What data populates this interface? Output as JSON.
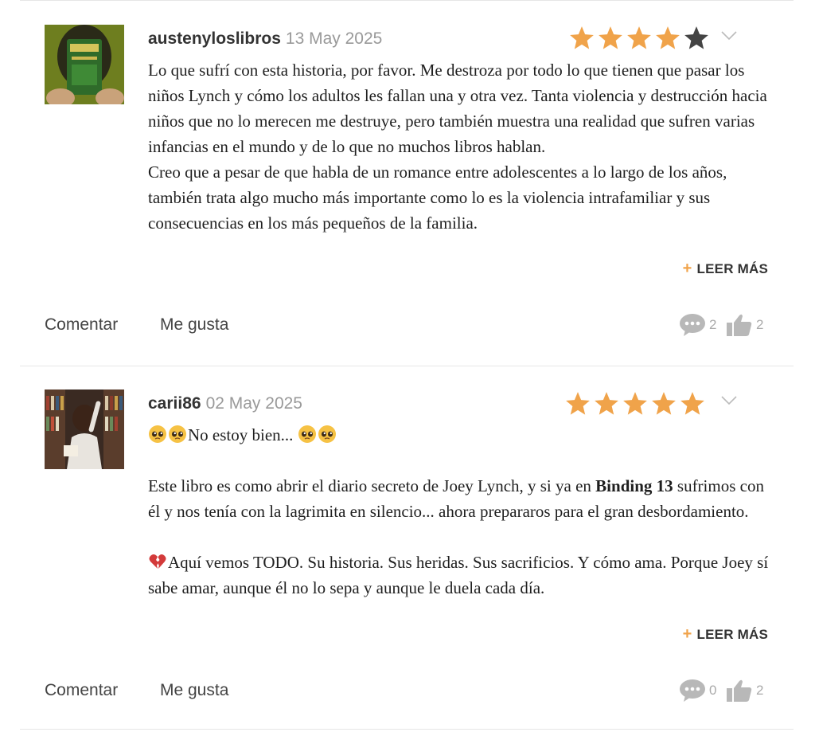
{
  "reviews": [
    {
      "username": "austenyloslibros",
      "date": "13 May 2025",
      "rating": 4,
      "max_rating": 5,
      "body_paragraphs": [
        "Lo que sufrí con esta historia, por favor. Me destroza por todo lo que tienen que pasar los niños Lynch y cómo los adultos les fallan una y otra vez. Tanta violencia y destrucción hacia niños que no lo merecen me destruye, pero también muestra una realidad que sufren varias infancias en el mundo y de lo que no muchos libros hablan.",
        "Creo que a pesar de que habla de un romance entre adolescentes a lo largo de los años, también trata algo mucho más importante como lo es la violencia intrafamiliar y sus consecuencias en los más pequeños de la familia."
      ],
      "read_more": "LEER MÁS",
      "comment_label": "Comentar",
      "like_label": "Me gusta",
      "comments_count": "2",
      "likes_count": "2"
    },
    {
      "username": "carii86",
      "date": "02 May 2025",
      "rating": 5,
      "max_rating": 5,
      "line1_text": "No estoy bien... ",
      "line1_emojis": [
        "pleading-face",
        "pleading-face",
        "pleading-face",
        "pleading-face"
      ],
      "para2_before": "Este libro es como abrir el diario secreto de Joey Lynch, y si ya en ",
      "para2_bold": "Binding 13",
      "para2_after": " sufrimos con él y nos tenía con la lagrimita en silencio... ahora prepararos para el gran desbordamiento.",
      "para3_emoji": "broken-heart",
      "para3_text": "Aquí vemos TODO. Su historia. Sus heridas. Sus sacrificios. Y cómo ama. Porque Joey sí sabe amar, aunque él no lo sepa y aunque le duela cada día.",
      "read_more": "LEER MÁS",
      "comment_label": "Comentar",
      "like_label": "Me gusta",
      "comments_count": "0",
      "likes_count": "2"
    }
  ],
  "colors": {
    "star_filled": "#f0a34a",
    "star_empty": "#444444",
    "accent_plus": "#f0a34a",
    "muted_icon": "#b8b8b8"
  },
  "icons": [
    "star-icon",
    "chevron-down-icon",
    "plus-icon",
    "comment-bubble-icon",
    "thumbs-up-icon",
    "pleading-face-emoji",
    "broken-heart-emoji"
  ]
}
